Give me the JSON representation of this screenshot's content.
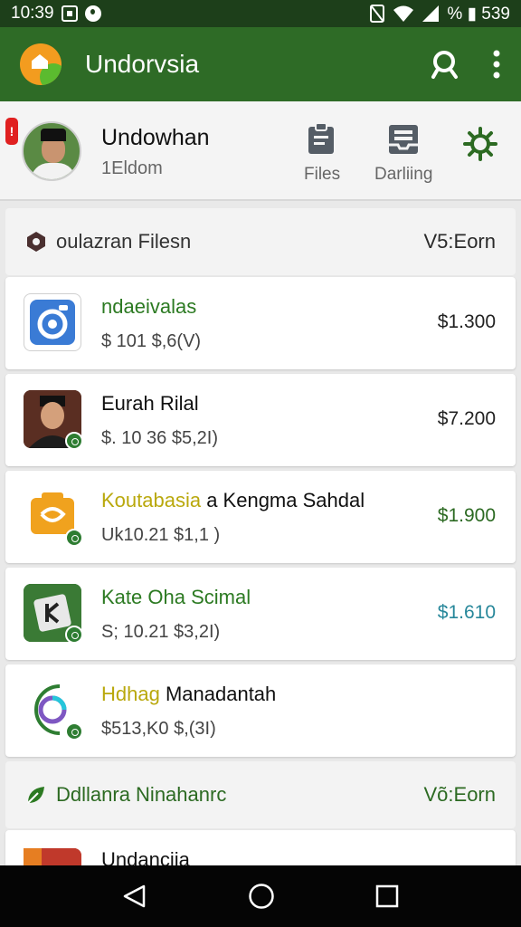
{
  "status": {
    "time": "10:39",
    "battery": "% ▮ 539"
  },
  "appbar": {
    "title": "Undorvsia"
  },
  "profile": {
    "notif_badge": "!",
    "name": "Undowhan",
    "subtitle": "1Eldom",
    "actions": [
      {
        "label": "Files"
      },
      {
        "label": "Darliing"
      }
    ]
  },
  "sections": [
    {
      "title": "oulazran Filesn",
      "value": "V5:Eorn"
    },
    {
      "title": "Ddllanra Ninahanrc",
      "value": "Võ:Eorn"
    }
  ],
  "rows": [
    {
      "title": "ndaeivalas",
      "meta": "$  101  $,6(V)",
      "price": "$1.300"
    },
    {
      "title": "Eurah Rilal",
      "meta": "$. 10 36 $5,2I)",
      "price": "$7.200"
    },
    {
      "title_hl": "Koutabasia",
      "title": " a Kengma Sahdal",
      "meta": "Uk10.21 $1,1 )",
      "price": "$1.900"
    },
    {
      "title": "Kate Oha Scimal",
      "meta": "S; 10.21 $3,2I)",
      "price": "$1.610"
    },
    {
      "title_hl": "Hdhag",
      "title": " Manadantah",
      "meta": "$513,K0 $,(3I)",
      "price": ""
    },
    {
      "title": "Undanciia"
    }
  ],
  "colors": {
    "appbar": "#2e6b26",
    "statusbar": "#1d3f1a",
    "accent_green": "#2c6a22",
    "teal_price": "#27879a"
  },
  "icons": [
    "search-icon",
    "more-vert-icon",
    "clipboard-icon",
    "inbox-icon",
    "settings-gear-icon",
    "back-icon",
    "home-icon",
    "recents-icon"
  ]
}
